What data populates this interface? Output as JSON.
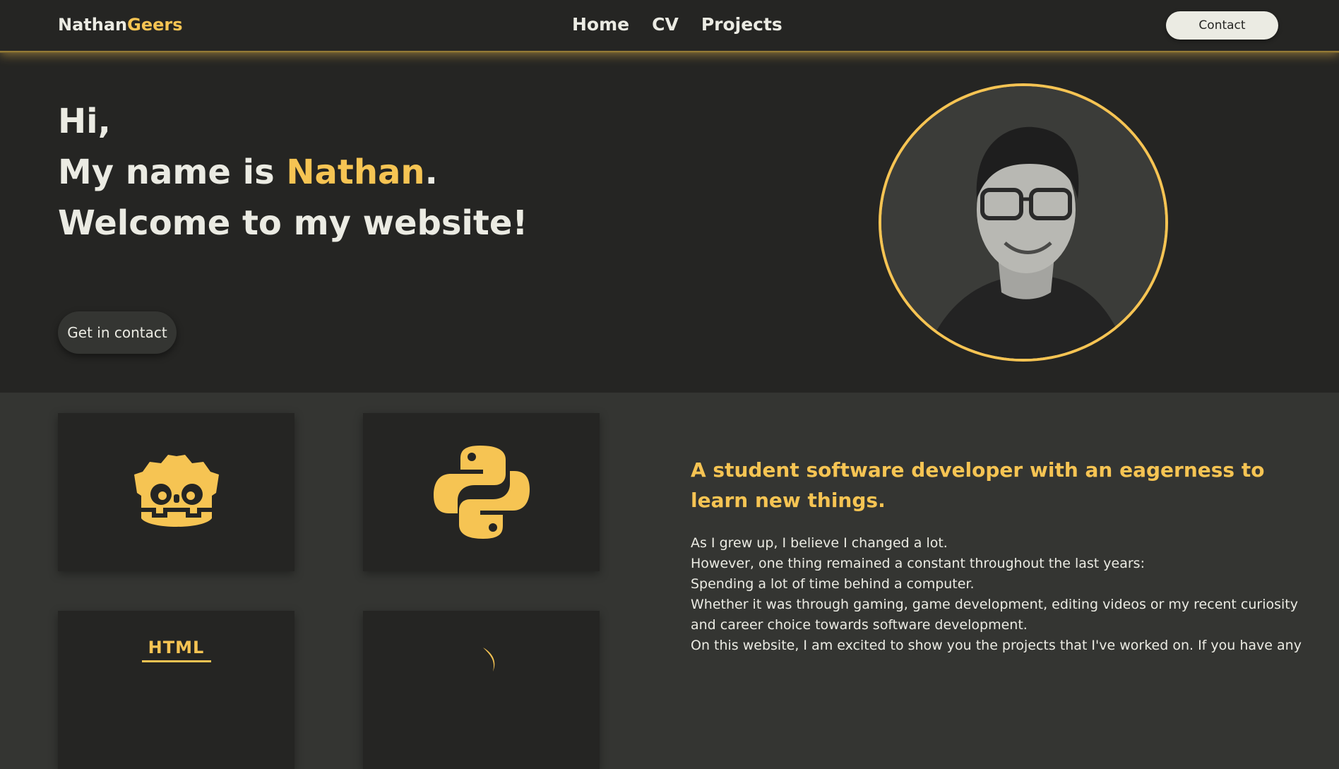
{
  "nav": {
    "brand_first": "Nathan",
    "brand_second": "Geers",
    "links": [
      {
        "label": "Home"
      },
      {
        "label": "CV"
      },
      {
        "label": "Projects"
      }
    ],
    "contact_label": "Contact"
  },
  "hero": {
    "line1": "Hi,",
    "line2_prefix": "My name is ",
    "line2_name": "Nathan",
    "line2_suffix": ".",
    "line3": "Welcome to my website!",
    "cta_label": "Get in contact"
  },
  "skills": {
    "cards": [
      {
        "icon": "godot-icon"
      },
      {
        "icon": "python-icon"
      },
      {
        "icon": "html-icon",
        "label": "HTML"
      },
      {
        "icon": "swift-icon"
      }
    ]
  },
  "about": {
    "heading": "A student software developer with an eagerness to learn new things.",
    "lines": [
      "As I grew up, I believe I changed a lot.",
      "However, one thing remained a constant throughout the last years:",
      "Spending a lot of time behind a computer.",
      "Whether it was through gaming, game development, editing videos or my recent curiosity",
      "and career choice towards software development.",
      "On this website, I am excited to show you the projects that I've worked on. If you have any"
    ]
  },
  "colors": {
    "accent": "#f6c453",
    "dark": "#252523",
    "mid": "#343532",
    "light": "#ebebe3"
  }
}
